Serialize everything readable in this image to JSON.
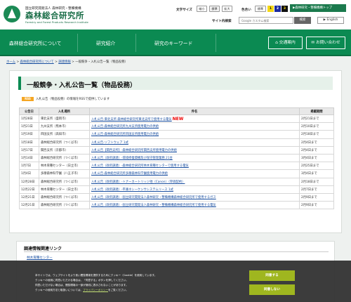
{
  "header": {
    "logo_sub": "国立研究開発法人 森林研究・整備機構",
    "logo_main": "森林総合研究所",
    "logo_en": "Forestry and Forest Products Research Institute",
    "text_size_label": "文字サイズ",
    "text_size_options": [
      "縮小",
      "標準",
      "拡大"
    ],
    "color_label": "色合い",
    "color_standard": "標準",
    "color_options": [
      "1",
      "2",
      "3"
    ],
    "top_link": "▶森林研究・整備機構トップ",
    "search_label": "サイト内検索",
    "search_placeholder": "Google カスタム検索",
    "search_button": "検索",
    "english": "▶ English"
  },
  "nav": {
    "items": [
      "森林総合研究所について",
      "研究紹介",
      "研究のキーワード"
    ],
    "access": "⌂ 交通案内",
    "contact": "✉ お問い合わせ"
  },
  "breadcrumb": {
    "home": "ホーム",
    "about": "森林総合研究所について",
    "procurement": "調達情報",
    "current": "一般競争・入札公告一覧（物品役務）",
    "separator": " > "
  },
  "page": {
    "title": "一般競争・入札公告一覧（物品役務）",
    "rss_badge": "RSS",
    "rss_text": "入札公告（物品役務）の情報をRSSで提供しています",
    "table": {
      "headers": [
        "公告日",
        "入札場所",
        "件名",
        "掲載期間"
      ],
      "rows": [
        {
          "date": "1月28日",
          "place": "東北支所（盛岡市）",
          "subject": "入札公告-東北支所 森林総合研究所東北支所で使用する電気",
          "is_new": true,
          "period": "2月21日まで"
        },
        {
          "date": "1月21日",
          "place": "九州支所（熊本市）",
          "subject": "入札公告-森林総合研究所九州支所使用電力の供給",
          "is_new": false,
          "period": "2月10日まで"
        },
        {
          "date": "1月19日",
          "place": "四国支所（高知市）",
          "subject": "入札公告-森林総合研究所四国支所使用電力の供給",
          "is_new": false,
          "period": "2月18日まで"
        },
        {
          "date": "1月18日",
          "place": "森林総合研究所（つくば市）",
          "subject": "入札公告-ソフトウェア 1式",
          "is_new": false,
          "period": "2月4日まで"
        },
        {
          "date": "1月17日",
          "place": "関西支所（京都市）",
          "subject": "入札公告【関西支所】-森林総合研究所関西支所使用電力の供給",
          "is_new": false,
          "period": "2月4日まで"
        },
        {
          "date": "1月14日",
          "place": "森林総合研究所（つくば市）",
          "subject": "入札公告（政府調達）-環境修復資機及び保守管理業務 21台",
          "is_new": false,
          "period": "3月4日まで"
        },
        {
          "date": "1月7日",
          "place": "林木育種センター（日立市）",
          "subject": "入札公告（政府調達）-森林総合研究所林木育種センターで使用する電気",
          "is_new": false,
          "period": "2月25日まで"
        },
        {
          "date": "1月4日",
          "place": "多摩森林科学園（八王子市）",
          "subject": "入札公告-森林総合研究所多摩森林科学園使用電力の供給",
          "is_new": false,
          "period": "3月4日まで"
        },
        {
          "date": "12月28日",
          "place": "森林総合研究所（つくば市）",
          "subject": "入札公告（政府調達）-トナーカートリッジ他（Canon）（単価契約）",
          "is_new": false,
          "period": "2月18日まで"
        },
        {
          "date": "12月22日",
          "place": "林木育種センター（日立市）",
          "subject": "入札公告（政府調達）-平庫ネシーケンサシステムリース 1式",
          "is_new": false,
          "period": "2月7日まで"
        },
        {
          "date": "12月21日",
          "place": "森林総合研究所（つくば市）",
          "subject": "入札公告（政府調達）-国立研究開発法人森林研究・整備機構森林総合研究所で使用するガス",
          "is_new": false,
          "period": "2月9日まで"
        },
        {
          "date": "12月21日",
          "place": "森林総合研究所（つくば市）",
          "subject": "入札公告（政府調達）-国立研究開発法人森林研究・整備機構森林総合研究所で使用する電気",
          "is_new": false,
          "period": "2月9日まで"
        }
      ]
    },
    "new_label": "NEW"
  },
  "related": {
    "title": "調達情報関連リンク",
    "link": "林木育種センター"
  },
  "cookie": {
    "lines": [
      "本サイトでは、ウェブサイトをより良い閲覧環境を提供するためにクッキー（Cookie）を使用しています。",
      "クッキーの使用に同意いただける場合は、「同意する」ボタンを押してください。",
      "同意いただけない場合は、閲覧環境の一部が適切に表示されないことがあります。",
      "クッキーの使用方法と取扱いについては、"
    ],
    "policy_link": "プライバシーポリシー",
    "policy_suffix": "をご覧ください。",
    "agree": "同意する",
    "disagree": "同意しない"
  },
  "colors": {
    "brand_green": "#0b8a52",
    "link_blue": "#1a4fa0",
    "new_red": "#e00000",
    "cookie_button": "#9fb61f"
  }
}
